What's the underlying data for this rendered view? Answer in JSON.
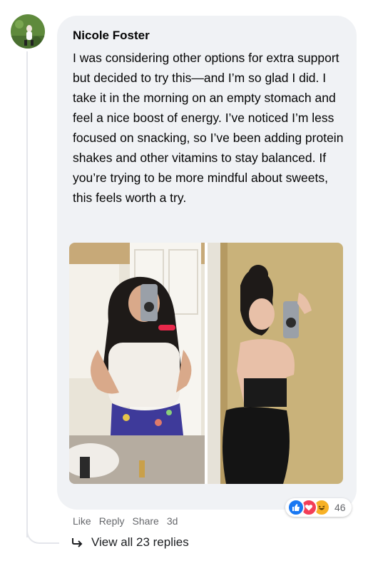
{
  "comment": {
    "author": "Nicole Foster",
    "text": "I was considering other options for extra support but decided to try this—and I’m so glad I did. I take it in the morning on an empty stomach and feel a nice boost of energy. I’ve noticed I’m less focused on snacking, so I’ve been adding protein shakes and other vitamins to stay balanced. If you’re trying to be more mindful about sweets, this feels worth a try."
  },
  "actions": {
    "like_label": "Like",
    "reply_label": "Reply",
    "share_label": "Share",
    "timestamp": "3d"
  },
  "reactions": {
    "types": [
      "like-icon",
      "love-icon",
      "haha-icon"
    ],
    "count": "46",
    "colors": {
      "like": "#1877f2",
      "love": "#f33e58",
      "haha": "#f7b125"
    }
  },
  "replies": {
    "label": "View all 23 replies"
  }
}
